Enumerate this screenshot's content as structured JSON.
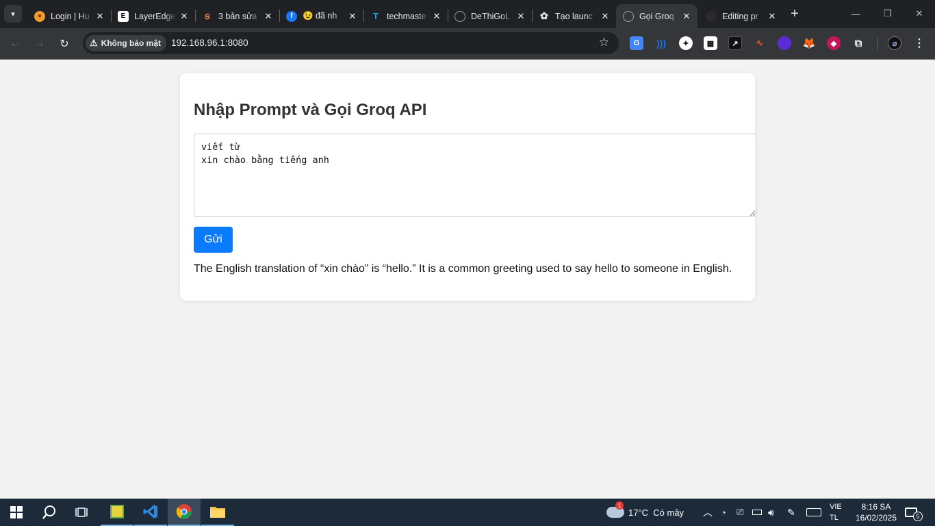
{
  "browser": {
    "tabs": [
      {
        "title": "Login | Hu",
        "favicon": "orange-circle-icon",
        "color": "#f29a2e"
      },
      {
        "title": "LayerEdge",
        "favicon": "layeredge-icon",
        "color": "#ffffff"
      },
      {
        "title": "3 bản sửa",
        "favicon": "claude-icon",
        "color": "#d97757"
      },
      {
        "title": "😉 đã nh",
        "favicon": "facebook-icon",
        "color": "#1877f2"
      },
      {
        "title": "techmaste",
        "favicon": "techmaster-icon",
        "color": "#1da1f2"
      },
      {
        "title": "DeThiGoL",
        "favicon": "globe-icon",
        "color": "#9aa0a6"
      },
      {
        "title": "Tạo launc",
        "favicon": "openai-icon",
        "color": "#e8eaed"
      },
      {
        "title": "Gọi Groq",
        "favicon": "globe-icon",
        "color": "#9aa0a6",
        "active": true
      },
      {
        "title": "Editing pr",
        "favicon": "dark-circle-icon",
        "color": "#222222"
      }
    ],
    "security_label": "Không bảo mật",
    "url": "192.168.96.1:8080",
    "extensions": [
      {
        "name": "translate-extension-icon",
        "color": "#4285f4"
      },
      {
        "name": "wave-extension-icon",
        "color": "#1a73e8"
      },
      {
        "name": "game-extension-icon",
        "color": "#ffffff"
      },
      {
        "name": "wallet-extension-icon",
        "color": "#ffffff"
      },
      {
        "name": "slash-extension-icon",
        "color": "#111111"
      },
      {
        "name": "signature-extension-icon",
        "color": "#e2552a"
      },
      {
        "name": "purple-extension-icon",
        "color": "#5b2bd6"
      },
      {
        "name": "metamask-extension-icon",
        "color": "#f6851b"
      },
      {
        "name": "pink-extension-icon",
        "color": "#c2185b"
      },
      {
        "name": "puzzle-extension-icon",
        "color": "#e8eaed"
      }
    ]
  },
  "page": {
    "heading": "Nhập Prompt và Gọi Groq API",
    "prompt_value": "viết từ\nxin chào bằng tiếng anh",
    "send_label": "Gửi",
    "result_text": "The English translation of “xin chào” is “hello.” It is a common greeting used to say hello to someone in English."
  },
  "taskbar": {
    "weather": "17°C  Có mây",
    "weather_badge": "1",
    "lang_top": "VIE",
    "lang_bottom": "TL",
    "time": "8:16 SA",
    "date": "16/02/2025",
    "notif_count": "5"
  }
}
